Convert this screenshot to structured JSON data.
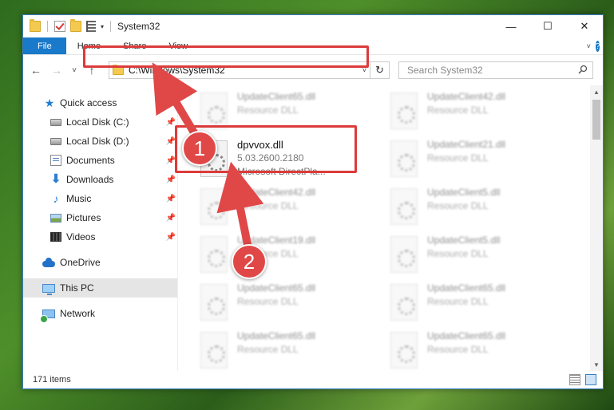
{
  "window": {
    "title": "System32",
    "controls": {
      "minimize": "—",
      "maximize": "☐",
      "close": "✕"
    }
  },
  "ribbon": {
    "tabs": [
      "File",
      "Home",
      "Share",
      "View"
    ],
    "collapse_glyph": "˅",
    "help_glyph": "?"
  },
  "nav": {
    "back": "←",
    "forward": "→",
    "recent": "˅",
    "up": "↑",
    "address": "C:\\Windows\\System32",
    "address_dropdown": "˅",
    "refresh": "↻",
    "search_placeholder": "Search System32"
  },
  "sidebar": {
    "items": [
      {
        "label": "Quick access",
        "icon": "star-icon",
        "pinned": false
      },
      {
        "label": "Local Disk (C:)",
        "icon": "disk-icon",
        "pinned": true
      },
      {
        "label": "Local Disk (D:)",
        "icon": "disk-icon",
        "pinned": true
      },
      {
        "label": "Documents",
        "icon": "documents-icon",
        "pinned": true
      },
      {
        "label": "Downloads",
        "icon": "downloads-icon",
        "pinned": true
      },
      {
        "label": "Music",
        "icon": "music-icon",
        "pinned": true
      },
      {
        "label": "Pictures",
        "icon": "pictures-icon",
        "pinned": true
      },
      {
        "label": "Videos",
        "icon": "videos-icon",
        "pinned": true
      },
      {
        "label": "OneDrive",
        "icon": "onedrive-icon",
        "pinned": false
      },
      {
        "label": "This PC",
        "icon": "this-pc-icon",
        "pinned": false,
        "selected": true
      },
      {
        "label": "Network",
        "icon": "network-icon",
        "pinned": false
      }
    ],
    "pin_glyph": "📌"
  },
  "files": [
    {
      "name": "UpdateClient65.dll",
      "line2": "Resource DLL",
      "blurred": true
    },
    {
      "name": "UpdateClient42.dll",
      "line2": "Resource DLL",
      "blurred": true
    },
    {
      "name": "dpvvox.dll",
      "line2": "5.03.2600.2180",
      "line3": "Microsoft DirectPla...",
      "blurred": false
    },
    {
      "name": "UpdateClient21.dll",
      "line2": "Resource DLL",
      "blurred": true
    },
    {
      "name": "UpdateClient42.dll",
      "line2": "Resource DLL",
      "blurred": true
    },
    {
      "name": "UpdateClient5.dll",
      "line2": "Resource DLL",
      "blurred": true
    },
    {
      "name": "UpdateClient19.dll",
      "line2": "Resource DLL",
      "blurred": true
    },
    {
      "name": "UpdateClient5.dll",
      "line2": "Resource DLL",
      "blurred": true
    },
    {
      "name": "UpdateClient65.dll",
      "line2": "Resource DLL",
      "blurred": true
    },
    {
      "name": "UpdateClient65.dll",
      "line2": "Resource DLL",
      "blurred": true
    },
    {
      "name": "UpdateClient65.dll",
      "line2": "Resource DLL",
      "blurred": true
    },
    {
      "name": "UpdateClient65.dll",
      "line2": "Resource DLL",
      "blurred": true
    }
  ],
  "status": {
    "item_count": "171 items"
  },
  "annotations": {
    "step1": "1",
    "step2": "2",
    "highlight_color": "#dc3b3b"
  }
}
